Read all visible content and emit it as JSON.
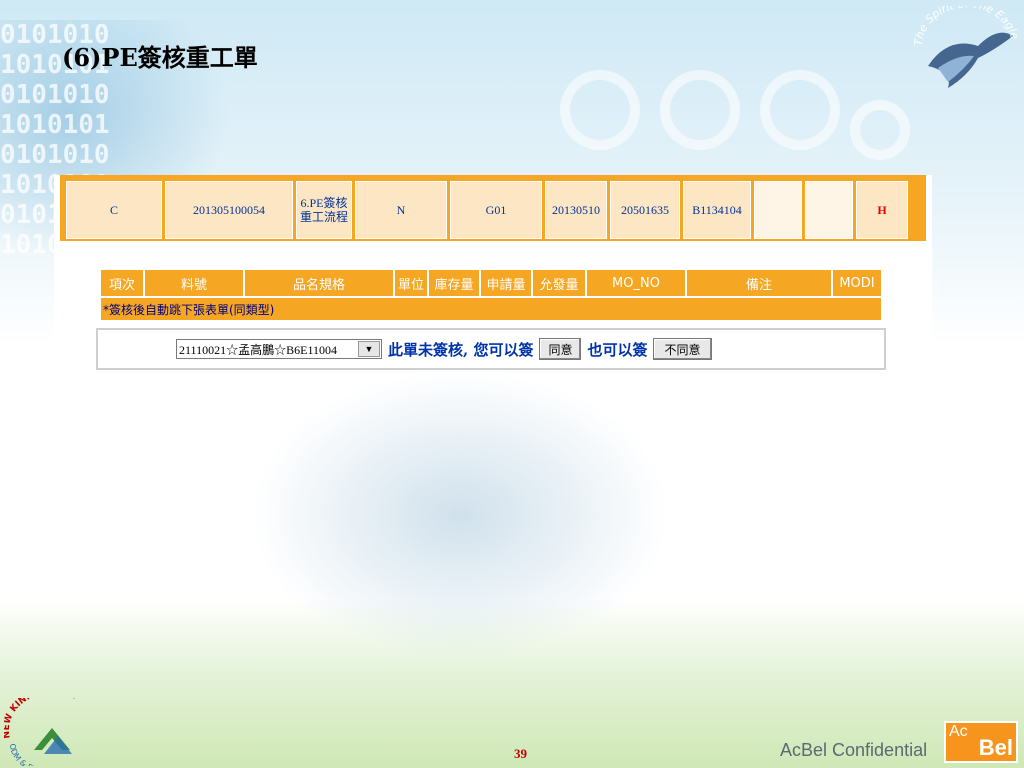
{
  "slide": {
    "title": "(6)PE簽核重工單",
    "logo_text": "The Spirit of The Eagle",
    "page_number": "39",
    "confidential": "AcBel Confidential",
    "brand_ac": "Ac",
    "brand_bel": "Bel",
    "footer_logo_text": "NEW KINPO VALUE",
    "footer_logo_sub": "ODM & EMS Partner"
  },
  "top_row": {
    "cells": [
      "C",
      "201305100054",
      "6.PE簽核重工流程",
      "N",
      "G01",
      "20130510",
      "20501635",
      "B1134104",
      "",
      "",
      "H"
    ]
  },
  "table": {
    "headers": [
      "項次",
      "料號",
      "品名規格",
      "單位",
      "庫存量",
      "申請量",
      "允發量",
      "MO_NO",
      "備注",
      "MODI"
    ],
    "auto_note": "*簽核後自動跳下張表單(同類型)"
  },
  "action": {
    "select_value": "21110021☆孟高鵬☆B6E11004",
    "message1": "此單未簽核, 您可以簽",
    "agree_label": "同意",
    "message2": "也可以簽",
    "disagree_label": "不同意"
  },
  "colors": {
    "orange": "#f5a623",
    "cell_bg": "#fde6c3",
    "text_blue": "#0033aa",
    "red": "#e00000"
  }
}
